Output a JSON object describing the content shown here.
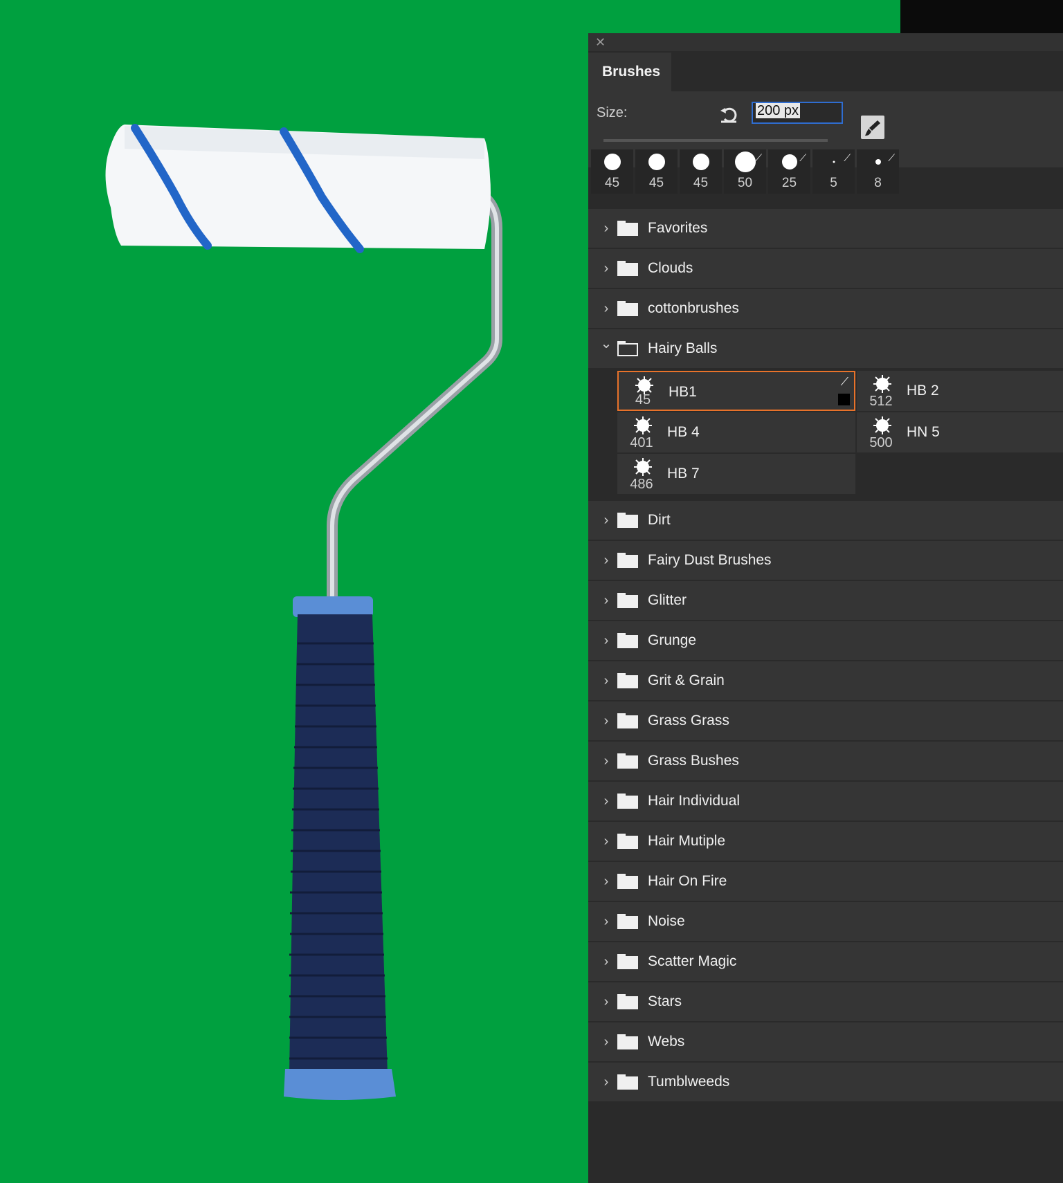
{
  "panel": {
    "tab_label": "Brushes",
    "size_label": "Size:",
    "size_value": "200 px",
    "size_slider_fraction": 0.75
  },
  "presets": [
    "45",
    "45",
    "45",
    "50",
    "25",
    "5",
    "8"
  ],
  "groups_before": [
    {
      "name": "Favorites",
      "expanded": false
    },
    {
      "name": "Clouds",
      "expanded": false
    },
    {
      "name": "cottonbrushes",
      "expanded": false
    },
    {
      "name": "Hairy Balls",
      "expanded": true
    }
  ],
  "hairy_balls_brushes": [
    {
      "size": "45",
      "name": "HB1",
      "selected": true
    },
    {
      "size": "512",
      "name": "HB 2",
      "selected": false
    },
    {
      "size": "401",
      "name": "HB 4",
      "selected": false
    },
    {
      "size": "500",
      "name": "HN 5",
      "selected": false
    },
    {
      "size": "486",
      "name": "HB 7",
      "selected": false
    }
  ],
  "groups_after": [
    {
      "name": "Dirt"
    },
    {
      "name": "Fairy Dust Brushes"
    },
    {
      "name": "Glitter"
    },
    {
      "name": "Grunge"
    },
    {
      "name": "Grit & Grain"
    },
    {
      "name": "Grass Grass"
    },
    {
      "name": "Grass Bushes"
    },
    {
      "name": "Hair Individual"
    },
    {
      "name": "Hair Mutiple"
    },
    {
      "name": "Hair On Fire"
    },
    {
      "name": "Noise"
    },
    {
      "name": "Scatter Magic"
    },
    {
      "name": "Stars"
    },
    {
      "name": "Webs"
    },
    {
      "name": "Tumblweeds"
    }
  ],
  "colors": {
    "canvas_green": "#00a03f",
    "selection_orange": "#e8722a",
    "input_border_blue": "#2f6dd0"
  }
}
